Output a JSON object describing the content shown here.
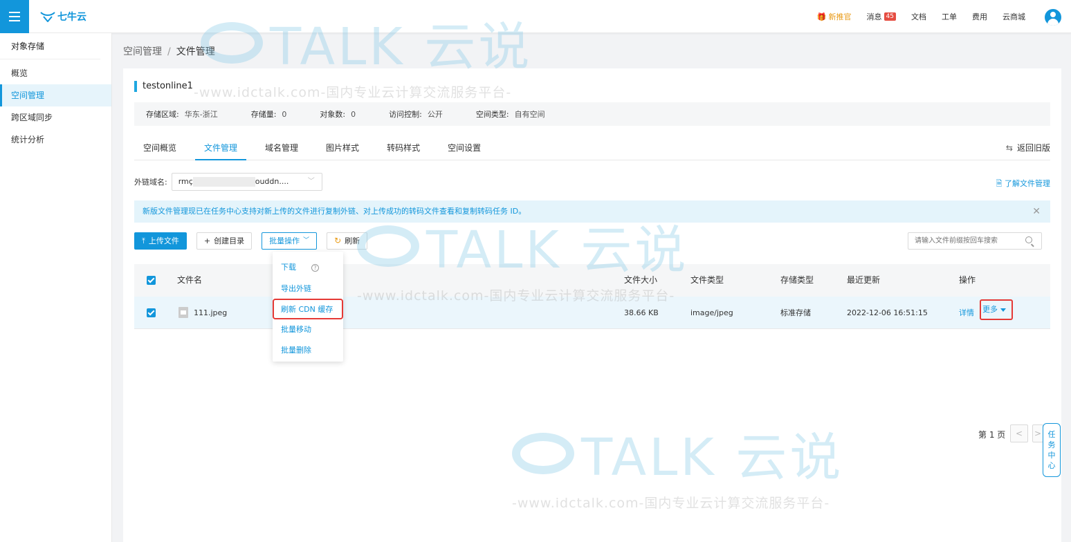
{
  "topbar": {
    "brand": "七牛云",
    "nav": [
      {
        "label": "新推官",
        "icon": "gift-icon",
        "highlight": true
      },
      {
        "label": "消息",
        "badge": "45"
      },
      {
        "label": "文档"
      },
      {
        "label": "工单"
      },
      {
        "label": "费用"
      },
      {
        "label": "云商城"
      }
    ]
  },
  "sidebar": {
    "title": "对象存储",
    "items": [
      {
        "label": "概览",
        "active": false
      },
      {
        "label": "空间管理",
        "active": true
      },
      {
        "label": "跨区域同步",
        "active": false
      },
      {
        "label": "统计分析",
        "active": false
      }
    ]
  },
  "breadcrumb": {
    "parent": "空间管理",
    "separator": "/",
    "current": "文件管理"
  },
  "bucket": {
    "name": "testonline1",
    "info": {
      "region_label": "存储区域:",
      "region": "华东-浙江",
      "storage_label": "存储量:",
      "storage": "0",
      "objects_label": "对象数:",
      "objects": "0",
      "access_label": "访问控制:",
      "access": "公开",
      "type_label": "空间类型:",
      "type": "自有空间"
    }
  },
  "tabs": [
    "空间概览",
    "文件管理",
    "域名管理",
    "图片样式",
    "转码样式",
    "空间设置"
  ],
  "active_tab": "文件管理",
  "back_old": "返回旧版",
  "domain": {
    "label": "外链域名:",
    "prefix": "rmç",
    "suffix": "ouddn...."
  },
  "learn_link": "了解文件管理",
  "notice": "新版文件管理现已在任务中心支持对新上传的文件进行复制外链、对上传成功的转码文件查看和复制转码任务 ID。",
  "toolbar": {
    "upload": "上传文件",
    "mkdir": "创建目录",
    "batch": "批量操作",
    "refresh": "刷新",
    "search_placeholder": "请输入文件前缀按回车搜索"
  },
  "dropdown": [
    "下载",
    "导出外链",
    "刷新 CDN 缓存",
    "批量移动",
    "批量删除"
  ],
  "table": {
    "headers": {
      "name": "文件名",
      "size": "文件大小",
      "type": "文件类型",
      "storage": "存储类型",
      "updated": "最近更新",
      "ops": "操作"
    },
    "rows": [
      {
        "name": "111.jpeg",
        "size": "38.66 KB",
        "type": "image/jpeg",
        "storage": "标准存储",
        "updated": "2022-12-06 16:51:15",
        "detail": "详情",
        "more": "更多"
      }
    ]
  },
  "pager": {
    "page_label": "第 1 页",
    "prev": "<",
    "next": ">"
  },
  "task_center": "任务中心",
  "watermark": {
    "brand": "TALK 云说",
    "url": "-www.idctalk.com-国内专业云计算交流服务平台-"
  },
  "colors": {
    "accent": "#1296db",
    "highlight_border": "#e53935",
    "gift": "#e99b17"
  }
}
